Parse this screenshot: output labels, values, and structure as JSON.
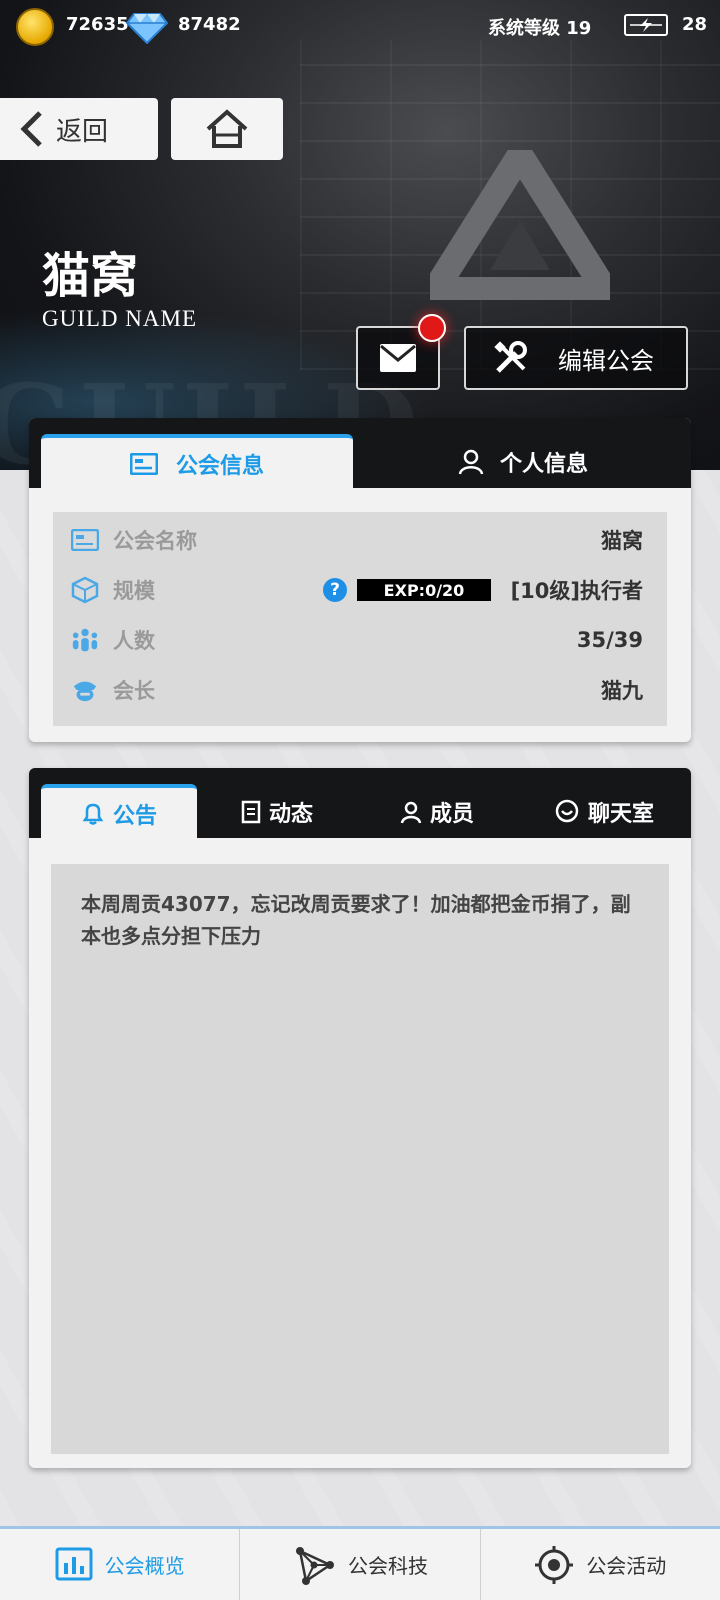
{
  "status": {
    "coins": "72635",
    "gems": "87482",
    "system_level": "系统等级 19",
    "energy": "28"
  },
  "nav": {
    "back_label": "返回"
  },
  "guild": {
    "title": "猫窝",
    "subtitle": "GUILD NAME",
    "edit_label": "编辑公会"
  },
  "info_tabs": [
    {
      "label": "公会信息",
      "active": true
    },
    {
      "label": "个人信息",
      "active": false
    }
  ],
  "info_rows": {
    "name": {
      "label": "公会名称",
      "value": "猫窝"
    },
    "scale": {
      "label": "规模",
      "help": "?",
      "exp": "EXP:0/20",
      "value": "[10级]执行者"
    },
    "members": {
      "label": "人数",
      "value": "35/39"
    },
    "leader": {
      "label": "会长",
      "value": "猫九"
    }
  },
  "notice_tabs": [
    {
      "label": "公告",
      "active": true
    },
    {
      "label": "动态",
      "active": false
    },
    {
      "label": "成员",
      "active": false
    },
    {
      "label": "聊天室",
      "active": false
    }
  ],
  "notice_text": "本周周贡43077，忘记改周贡要求了！加油都把金币捐了，副本也多点分担下压力",
  "bottom_nav": [
    {
      "label": "公会概览",
      "active": true
    },
    {
      "label": "公会科技",
      "active": false
    },
    {
      "label": "公会活动",
      "active": false
    }
  ],
  "colors": {
    "accent": "#1d9be6",
    "notification": "#e01818",
    "header_bg": "#141518"
  }
}
